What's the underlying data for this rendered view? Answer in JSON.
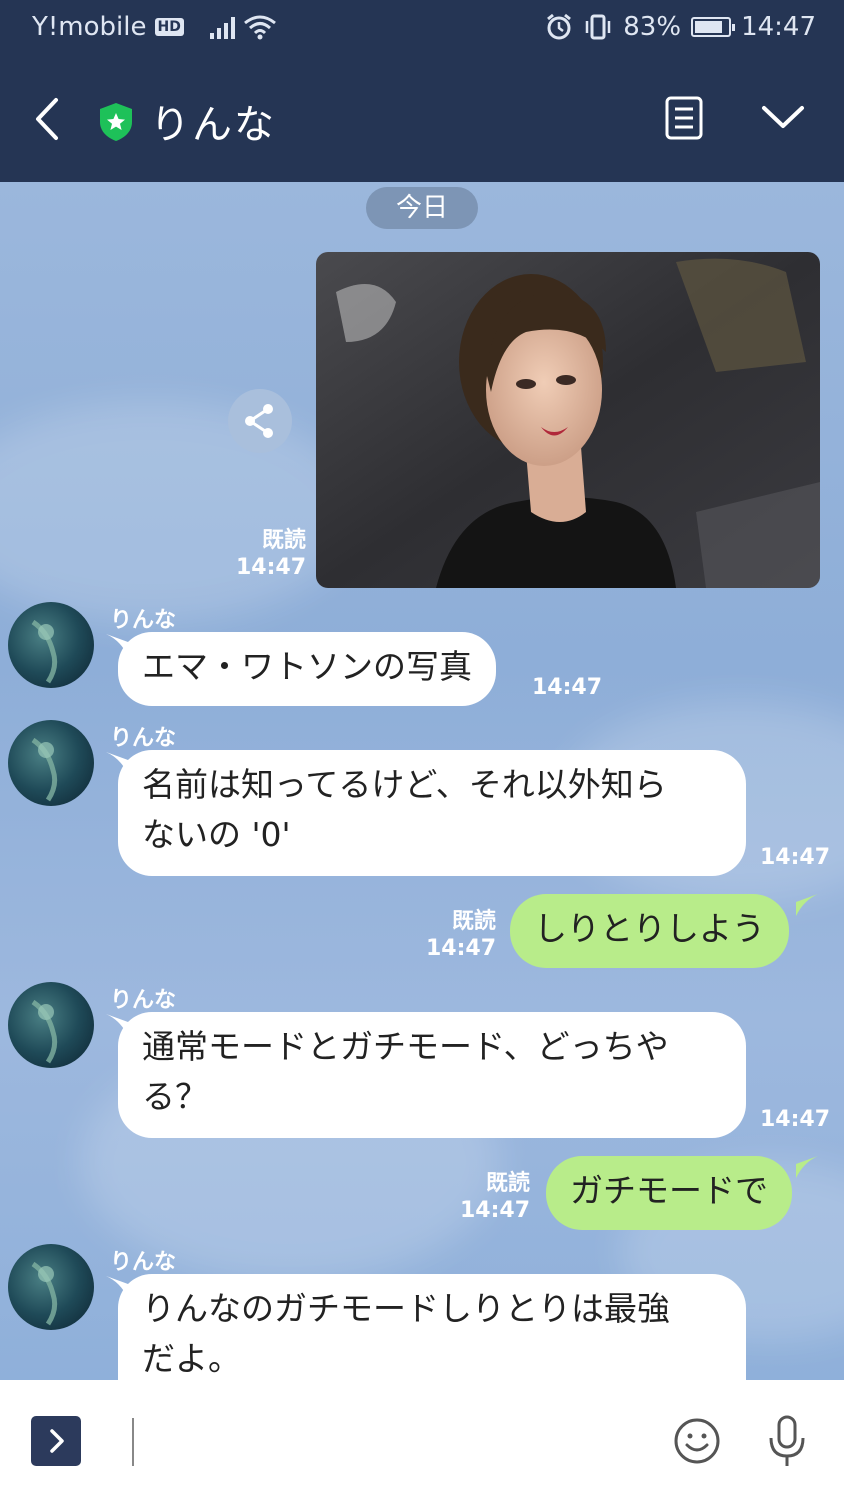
{
  "status_bar": {
    "carrier": "Y!mobile",
    "hd_badge": "HD",
    "battery_percent": "83%",
    "battery_level": 0.83,
    "time": "14:47"
  },
  "header": {
    "title": "りんな",
    "back_icon": "chevron-left-icon",
    "shield_icon": "shield-star-icon",
    "menu_icon": "notes-icon",
    "dropdown_icon": "chevron-down-icon"
  },
  "chat": {
    "date_label": "今日",
    "messages": [
      {
        "type": "image",
        "from": "me",
        "read": "既読",
        "time": "14:47"
      },
      {
        "type": "text",
        "from": "りんな",
        "sender": "りんな",
        "lines": [
          "エマ・ワトソンの写真"
        ],
        "time": "14:47"
      },
      {
        "type": "text",
        "from": "りんな",
        "sender": "りんな",
        "lines": [
          "名前は知ってるけど、それ以外知ら",
          "ないの '0'"
        ],
        "time": "14:47"
      },
      {
        "type": "text",
        "from": "me",
        "text": "しりとりしよう",
        "read": "既読",
        "time": "14:47"
      },
      {
        "type": "text",
        "from": "りんな",
        "sender": "りんな",
        "lines": [
          "通常モードとガチモード、どっちや",
          "る？"
        ],
        "time": "14:47"
      },
      {
        "type": "text",
        "from": "me",
        "text": "ガチモードで",
        "read": "既読",
        "time": "14:47"
      },
      {
        "type": "text",
        "from": "りんな",
        "sender": "りんな",
        "lines": [
          "りんなのガチモードしりとりは最強",
          "だよ。"
        ]
      }
    ]
  },
  "input_bar": {
    "expand_icon": "chevron-right-icon",
    "emoji_icon": "smiley-icon",
    "mic_icon": "microphone-icon"
  },
  "colors": {
    "header_bg": "#253554",
    "chat_bg": "#8fafd6",
    "outgoing_bubble": "#b8ec8a",
    "incoming_bubble": "#ffffff"
  }
}
